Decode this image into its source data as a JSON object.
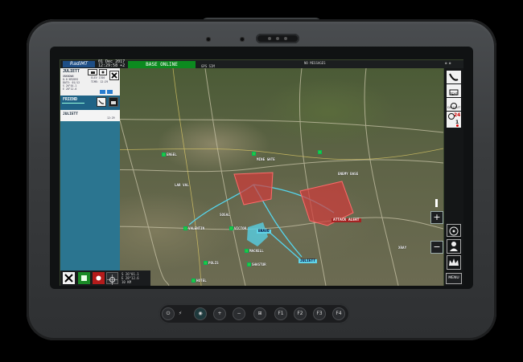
{
  "topbar": {
    "logo": "RadiMT",
    "date": "01 Dec 2017",
    "time": "12:29:58 +2",
    "status": "BASE ONLINE",
    "status_color": "#0c8a1f",
    "gps_text": "GPS SIM",
    "right_text": "NO MESSAGES"
  },
  "panel": {
    "title": "JULIETT",
    "lines": [
      "UNKNOWN",
      "0.0 KM/DEG",
      "DATE: 01/12",
      "S 26°01.1",
      "E 28°12.6",
      "ELEV 1700",
      "TIME: 12:29"
    ],
    "friend_label": "FRIEND",
    "contact_name": "JULIETT",
    "contact_time": "12:29",
    "colors": {
      "panel": "#2b7590",
      "friend": "#1f6386"
    }
  },
  "bottom_tools": {
    "readout": [
      "S 26°01.1",
      "E 28°12.6",
      "10 KM"
    ]
  },
  "right_toolbar": {
    "text_label": "TEXT",
    "callout_label": "CALLOUT",
    "count": "24",
    "alert_count": "1",
    "menu_label": "MENU"
  },
  "map": {
    "labels": {
      "engel": "ENGEL",
      "lar_val": "LAR VAL",
      "mine_gate": "MINE GATE",
      "enemy_base": "ENEMY BASE",
      "valentin": "VALENTIN",
      "victor": "VICTOR",
      "bravo": "BRAVO",
      "sosal": "SOSAL",
      "polis": "POLIS",
      "mackell": "MACKELL",
      "shaster": "SHASTUR",
      "juliett": "JULIETT",
      "attack_alert": "ATTACK ALERT",
      "xray": "XRAY",
      "hotel": "HOTEL"
    },
    "zone_color": "#d23a3a"
  },
  "hardware_buttons": [
    "+",
    "−",
    "⊞",
    "F1",
    "F2",
    "F3",
    "F4"
  ]
}
